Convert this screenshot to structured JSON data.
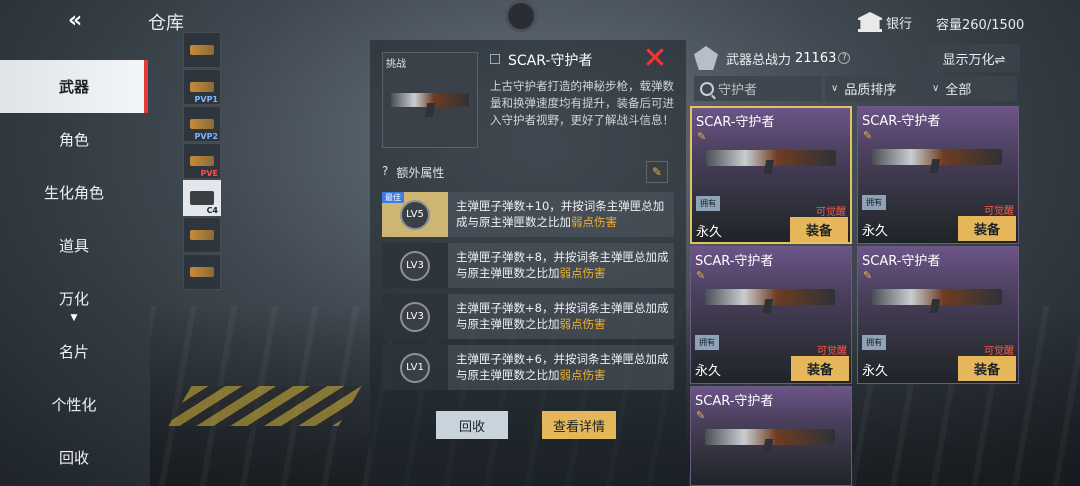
{
  "header": {
    "title": "仓库",
    "bank_label": "银行",
    "capacity": "容量260/1500"
  },
  "nav": {
    "items": [
      {
        "label": "武器",
        "active": true
      },
      {
        "label": "角色"
      },
      {
        "label": "生化角色"
      },
      {
        "label": "道具"
      },
      {
        "label": "万化"
      },
      {
        "label": "名片"
      },
      {
        "label": "个性化"
      },
      {
        "label": "回收"
      }
    ]
  },
  "categories": [
    {
      "tag": ""
    },
    {
      "tag": "PVP1"
    },
    {
      "tag": "PVP2"
    },
    {
      "tag": "PVE"
    },
    {
      "tag": "C4"
    },
    {
      "tag": ""
    },
    {
      "tag": ""
    }
  ],
  "detail": {
    "thumb_tag": "挑战",
    "name": "SCAR-守护者",
    "description": "上古守护者打造的神秘步枪，载弹数量和换弹速度均有提升，装备后可进入守护者视野，更好了解战斗信息！",
    "extra_header": "额外属性",
    "best_tag": "最佳",
    "attributes": [
      {
        "level": "LV5",
        "text": "主弹匣子弹数+10，并按词条主弹匣总加成与原主弹匣数之比加",
        "highlight": "弱点伤害"
      },
      {
        "level": "LV3",
        "text": "主弹匣子弹数+8，并按词条主弹匣总加成与原主弹匣数之比加",
        "highlight": "弱点伤害"
      },
      {
        "level": "LV3",
        "text": "主弹匣子弹数+8，并按词条主弹匣总加成与原主弹匣数之比加",
        "highlight": "弱点伤害"
      },
      {
        "level": "LV1",
        "text": "主弹匣子弹数+6，并按词条主弹匣总加成与原主弹匣数之比加",
        "highlight": "弱点伤害"
      }
    ],
    "recycle_label": "回收",
    "view_detail_label": "查看详情"
  },
  "right": {
    "power_label": "武器总战力",
    "power_value": "21163",
    "wanhua_label": "显示万化⇌",
    "search_placeholder": "守护者",
    "sort_label": "品质排序",
    "filter_label": "全部",
    "cards": [
      {
        "name": "SCAR-守护者",
        "own": "拥有",
        "awaken": "可觉醒",
        "perm": "永久",
        "equip": "装备",
        "selected": true
      },
      {
        "name": "SCAR-守护者",
        "own": "拥有",
        "awaken": "可觉醒",
        "perm": "永久",
        "equip": "装备"
      },
      {
        "name": "SCAR-守护者",
        "own": "拥有",
        "awaken": "可觉醒",
        "perm": "永久",
        "equip": "装备"
      },
      {
        "name": "SCAR-守护者",
        "own": "拥有",
        "awaken": "可觉醒",
        "perm": "永久",
        "equip": "装备"
      },
      {
        "name": "SCAR-守护者",
        "own": "",
        "awaken": "",
        "perm": "",
        "equip": ""
      }
    ]
  }
}
